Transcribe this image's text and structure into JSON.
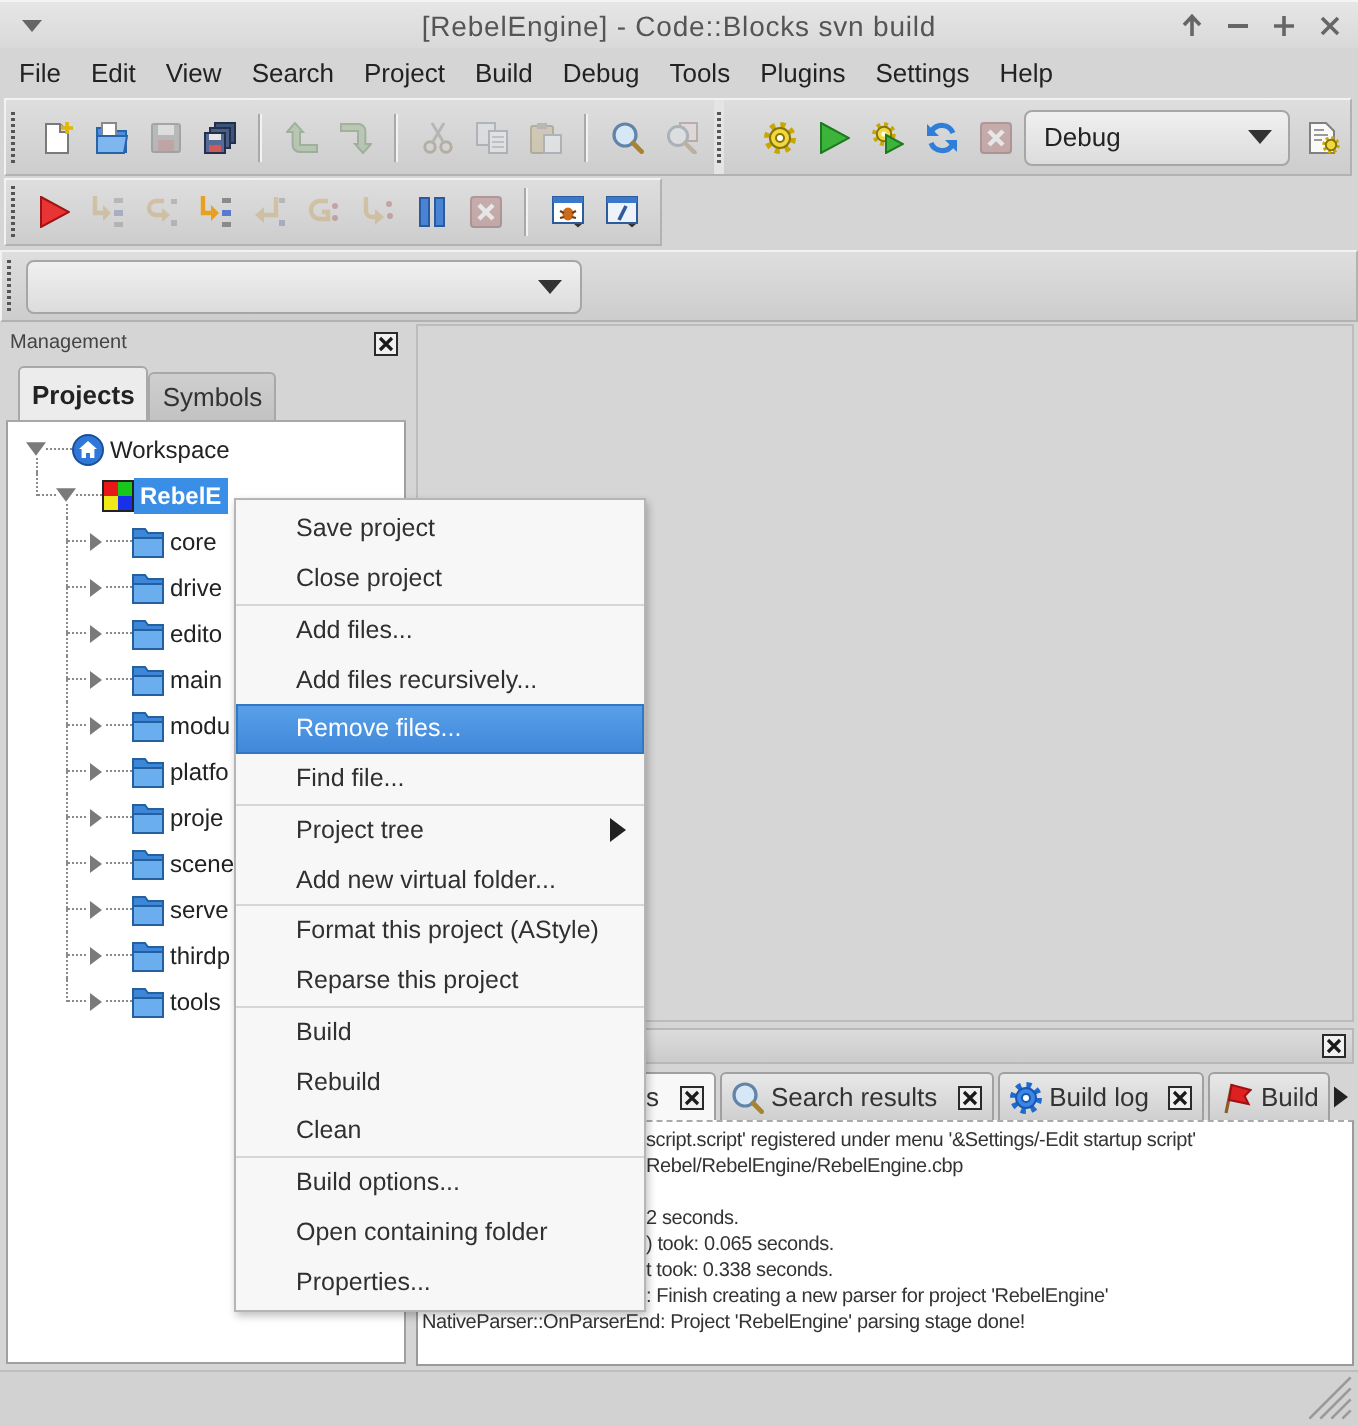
{
  "window": {
    "title": "[RebelEngine] - Code::Blocks svn build"
  },
  "menu_bar": [
    "File",
    "Edit",
    "View",
    "Search",
    "Project",
    "Build",
    "Debug",
    "Tools",
    "Plugins",
    "Settings",
    "Help"
  ],
  "main_toolbar": {
    "buttons": [
      {
        "disabled": false
      },
      {
        "disabled": false
      },
      {
        "disabled": true
      },
      {
        "disabled": false
      },
      {
        "disabled": true
      },
      {
        "disabled": true
      },
      {
        "disabled": true
      },
      {
        "disabled": true
      },
      {
        "disabled": true
      },
      {
        "disabled": false
      },
      {
        "disabled": true
      }
    ]
  },
  "compiler_toolbar": {
    "buttons": [
      {
        "disabled": false
      },
      {
        "disabled": false
      },
      {
        "disabled": false
      },
      {
        "disabled": false
      },
      {
        "disabled": true
      }
    ],
    "build_target": "Debug"
  },
  "debugger_toolbar": {
    "buttons": [
      {
        "disabled": false
      },
      {
        "disabled": true
      },
      {
        "disabled": true
      },
      {
        "disabled": false
      },
      {
        "disabled": true
      },
      {
        "disabled": true
      },
      {
        "disabled": true
      },
      {
        "disabled": false
      },
      {
        "disabled": true
      },
      {
        "disabled": false
      },
      {
        "disabled": false
      }
    ]
  },
  "management_panel": {
    "title": "Management",
    "tabs": [
      {
        "label": "Projects",
        "selected": true
      },
      {
        "label": "Symbols",
        "selected": false
      }
    ],
    "tree": [
      {
        "label": "Workspace",
        "expanded": true,
        "selected": false,
        "children": [
          {
            "label": "RebelE",
            "expanded": true,
            "selected": true,
            "children": [
              {
                "label": "core",
                "expanded": false,
                "selected": false
              },
              {
                "label": "drive",
                "expanded": false,
                "selected": false
              },
              {
                "label": "edito",
                "expanded": false,
                "selected": false
              },
              {
                "label": "main",
                "expanded": false,
                "selected": false
              },
              {
                "label": "modu",
                "expanded": false,
                "selected": false
              },
              {
                "label": "platfo",
                "expanded": false,
                "selected": false
              },
              {
                "label": "proje",
                "expanded": false,
                "selected": false
              },
              {
                "label": "scene",
                "expanded": false,
                "selected": false
              },
              {
                "label": "serve",
                "expanded": false,
                "selected": false
              },
              {
                "label": "thirdp",
                "expanded": false,
                "selected": false
              },
              {
                "label": "tools",
                "expanded": false,
                "selected": false
              }
            ]
          }
        ]
      }
    ]
  },
  "log_panel": {
    "tabs": [
      {
        "label": "s",
        "partly_hidden": true,
        "selected": true,
        "close_button": true
      },
      {
        "label": "Search results",
        "partly_hidden": false,
        "selected": false,
        "close_button": true
      },
      {
        "label": "Build log",
        "partly_hidden": false,
        "selected": false,
        "close_button": true
      },
      {
        "label": "Build",
        "partly_hidden": false,
        "selected": false,
        "close_button": false
      }
    ],
    "lines": [
      {
        "text": "script.script' registered under menu '&Settings/-Edit startup script'",
        "partly_hidden": true,
        "space_before": false
      },
      {
        "text": "Rebel/RebelEngine/RebelEngine.cbp",
        "partly_hidden": true,
        "space_before": false
      },
      {
        "text": "2 seconds.",
        "partly_hidden": true,
        "space_before": true
      },
      {
        "text": ") took: 0.065 seconds.",
        "partly_hidden": true,
        "space_before": false
      },
      {
        "text": "t took: 0.338 seconds.",
        "partly_hidden": true,
        "space_before": false
      },
      {
        "text": ": Finish creating a new parser for project 'RebelEngine'",
        "partly_hidden": true,
        "space_before": false
      },
      {
        "text": "NativeParser::OnParserEnd: Project 'RebelEngine' parsing stage done!",
        "partly_hidden": false,
        "space_before": false
      }
    ]
  },
  "context_menu": {
    "groups": [
      [
        {
          "label": "Save project",
          "selected": false,
          "submenu": false
        },
        {
          "label": "Close project",
          "selected": false,
          "submenu": false
        }
      ],
      [
        {
          "label": "Add files...",
          "selected": false,
          "submenu": false
        },
        {
          "label": "Add files recursively...",
          "selected": false,
          "submenu": false
        },
        {
          "label": "Remove files...",
          "selected": true,
          "submenu": false
        },
        {
          "label": "Find file...",
          "selected": false,
          "submenu": false
        }
      ],
      [
        {
          "label": "Project tree",
          "selected": false,
          "submenu": true
        },
        {
          "label": "Add new virtual folder...",
          "selected": false,
          "submenu": false
        }
      ],
      [
        {
          "label": "Format this project (AStyle)",
          "selected": false,
          "submenu": false
        },
        {
          "label": "Reparse this project",
          "selected": false,
          "submenu": false
        }
      ],
      [
        {
          "label": "Build",
          "selected": false,
          "submenu": false
        },
        {
          "label": "Rebuild",
          "selected": false,
          "submenu": false
        },
        {
          "label": "Clean",
          "selected": false,
          "submenu": false
        }
      ],
      [
        {
          "label": "Build options...",
          "selected": false,
          "submenu": false
        },
        {
          "label": "Open containing folder",
          "selected": false,
          "submenu": false
        },
        {
          "label": "Properties...",
          "selected": false,
          "submenu": false
        }
      ]
    ]
  }
}
